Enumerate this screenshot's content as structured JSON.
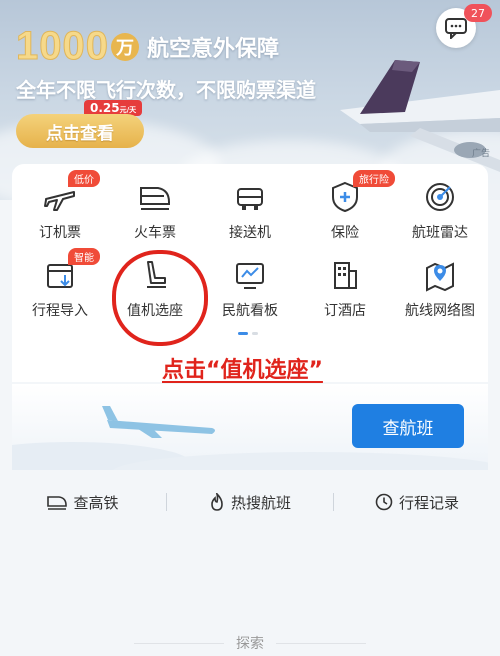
{
  "banner": {
    "big_number": "1000",
    "wan": "万",
    "title_rest": "航空意外保障",
    "subtitle": "全年不限飞行次数，不限购票渠道",
    "price": "0.25",
    "price_unit": "元/天",
    "cta": "点击查看",
    "ad_label": "广告"
  },
  "messages": {
    "icon": "chat-bubble-icon",
    "badge": "27"
  },
  "services": {
    "row1": [
      {
        "label": "订机票",
        "icon": "airplane-icon",
        "tag": "低价"
      },
      {
        "label": "火车票",
        "icon": "train-icon"
      },
      {
        "label": "接送机",
        "icon": "car-icon"
      },
      {
        "label": "保险",
        "icon": "shield-plus-icon",
        "tag": "旅行险"
      },
      {
        "label": "航班雷达",
        "icon": "radar-icon"
      }
    ],
    "row2": [
      {
        "label": "行程导入",
        "icon": "calendar-import-icon",
        "tag": "智能"
      },
      {
        "label": "值机选座",
        "icon": "seat-icon"
      },
      {
        "label": "民航看板",
        "icon": "dashboard-icon"
      },
      {
        "label": "订酒店",
        "icon": "hotel-icon"
      },
      {
        "label": "航线网络图",
        "icon": "map-pin-icon"
      }
    ]
  },
  "annotation": "点击“值机选座”",
  "search": {
    "button": "查航班"
  },
  "quick_links": [
    {
      "label": "查高铁",
      "icon": "train-icon"
    },
    {
      "label": "热搜航班",
      "icon": "flame-icon"
    },
    {
      "label": "行程记录",
      "icon": "clock-icon"
    }
  ],
  "explore": "探索",
  "colors": {
    "accent_blue": "#1f7fe2",
    "highlight_red": "#e0241c",
    "tag_red": "#f04b38",
    "gold": "#e8b64f"
  }
}
